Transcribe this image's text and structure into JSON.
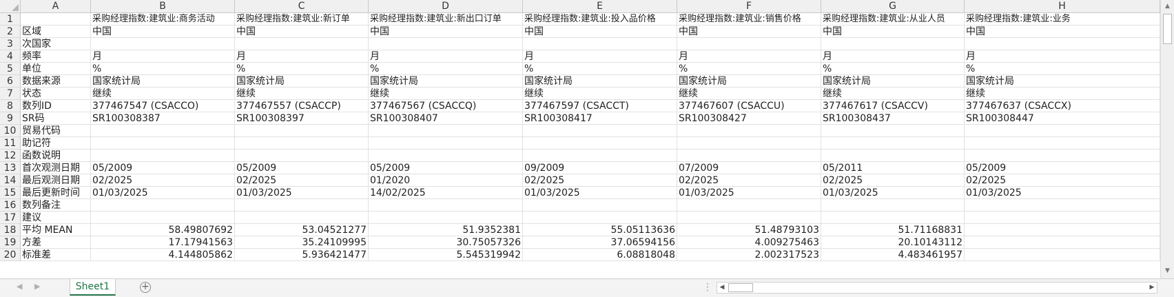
{
  "columns": [
    "A",
    "B",
    "C",
    "D",
    "E",
    "F",
    "G",
    "H"
  ],
  "rows": [
    [
      "",
      "采购经理指数:建筑业:商务活动",
      "采购经理指数:建筑业:新订单",
      "采购经理指数:建筑业:新出口订单",
      "采购经理指数:建筑业:投入品价格",
      "采购经理指数:建筑业:销售价格",
      "采购经理指数:建筑业:从业人员",
      "采购经理指数:建筑业:业务"
    ],
    [
      "区域",
      "中国",
      "中国",
      "中国",
      "中国",
      "中国",
      "中国",
      "中国"
    ],
    [
      "次国家",
      "",
      "",
      "",
      "",
      "",
      "",
      ""
    ],
    [
      "频率",
      "月",
      "月",
      "月",
      "月",
      "月",
      "月",
      "月"
    ],
    [
      "单位",
      "%",
      "%",
      "%",
      "%",
      "%",
      "%",
      "%"
    ],
    [
      "数据来源",
      "国家统计局",
      "国家统计局",
      "国家统计局",
      "国家统计局",
      "国家统计局",
      "国家统计局",
      "国家统计局"
    ],
    [
      "状态",
      "继续",
      "继续",
      "继续",
      "继续",
      "继续",
      "继续",
      "继续"
    ],
    [
      "数列ID",
      "377467547 (CSACCO)",
      "377467557 (CSACCP)",
      "377467567 (CSACCQ)",
      "377467597 (CSACCT)",
      "377467607 (CSACCU)",
      "377467617 (CSACCV)",
      "377467637 (CSACCX)"
    ],
    [
      "SR码",
      "SR100308387",
      "SR100308397",
      "SR100308407",
      "SR100308417",
      "SR100308427",
      "SR100308437",
      "SR100308447"
    ],
    [
      "贸易代码",
      "",
      "",
      "",
      "",
      "",
      "",
      ""
    ],
    [
      "助记符",
      "",
      "",
      "",
      "",
      "",
      "",
      ""
    ],
    [
      "函数说明",
      "",
      "",
      "",
      "",
      "",
      "",
      ""
    ],
    [
      "首次观测日期",
      "05/2009",
      "05/2009",
      "05/2009",
      "09/2009",
      "07/2009",
      "05/2011",
      "05/2009"
    ],
    [
      "最后观测日期",
      "02/2025",
      "02/2025",
      "01/2020",
      "02/2025",
      "02/2025",
      "02/2025",
      "02/2025"
    ],
    [
      "最后更新时间",
      "01/03/2025",
      "01/03/2025",
      "14/02/2025",
      "01/03/2025",
      "01/03/2025",
      "01/03/2025",
      "01/03/2025"
    ],
    [
      "数列备注",
      "",
      "",
      "",
      "",
      "",
      "",
      ""
    ],
    [
      "建议",
      "",
      "",
      "",
      "",
      "",
      "",
      ""
    ],
    [
      "平均 MEAN",
      "58.49807692",
      "53.04521277",
      "51.9352381",
      "55.05113636",
      "51.48793103",
      "51.71168831",
      ""
    ],
    [
      "方差",
      "17.17941563",
      "35.24109995",
      "30.75057326",
      "37.06594156",
      "4.009275463",
      "20.10143112",
      ""
    ],
    [
      "标准差",
      "4.144805862",
      "5.936421477",
      "5.545319942",
      "6.08818048",
      "2.002317523",
      "4.483461957",
      ""
    ]
  ],
  "sheet_tab": "Sheet1",
  "add_sheet_symbol": "+",
  "split_symbol": "⋮",
  "icons": {
    "scroll_up": "▲",
    "scroll_down": "▼",
    "scroll_left": "◀",
    "scroll_right": "▶",
    "nav_prev": "◀",
    "nav_next": "▶"
  },
  "colors": {
    "tab_accent": "#217346",
    "header_bg": "#f0f0f0",
    "grid_line": "#e1e1e1"
  }
}
